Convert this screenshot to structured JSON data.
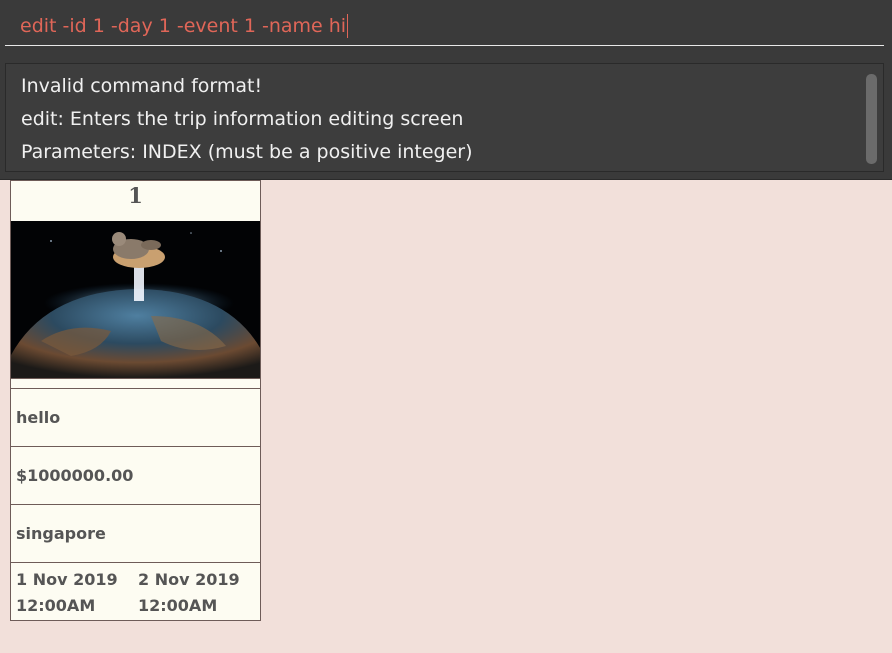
{
  "command_box": {
    "value": "edit -id 1 -day 1 -event 1 -name hi"
  },
  "result_display": {
    "lines": [
      "Invalid command format!",
      "edit: Enters the trip information editing screen",
      "Parameters: INDEX (must be a positive integer)"
    ]
  },
  "trip_card": {
    "index": "1",
    "name": "hello",
    "budget": "$1000000.00",
    "location": "singapore",
    "start_date": "1 Nov 2019",
    "start_time": "12:00AM",
    "end_date": "2 Nov 2019",
    "end_time": "12:00AM"
  },
  "colors": {
    "background": "#f2e0da",
    "command_text": "#e06658",
    "panel_dark": "#3a3a3a",
    "card_bg": "#fdfcf2"
  }
}
